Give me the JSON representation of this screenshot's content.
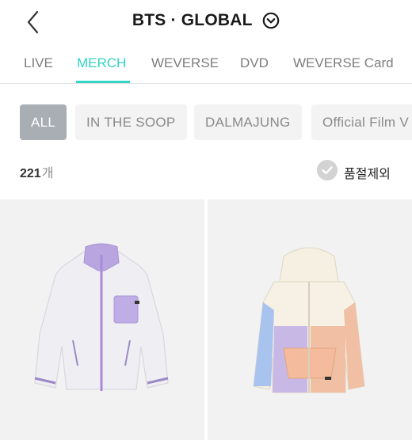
{
  "header": {
    "title": "BTS · GLOBAL",
    "back_icon": "chevron-left-icon",
    "title_icon": "chevron-down-circle-icon"
  },
  "tabs": [
    {
      "label": "LIVE",
      "active": false
    },
    {
      "label": "MERCH",
      "active": true
    },
    {
      "label": "WEVERSE",
      "active": false
    },
    {
      "label": "DVD",
      "active": false
    },
    {
      "label": "WEVERSE Card",
      "active": false
    }
  ],
  "chips": [
    {
      "label": "ALL",
      "active": true
    },
    {
      "label": "IN THE SOOP",
      "active": false
    },
    {
      "label": "DALMAJUNG",
      "active": false
    },
    {
      "label": "Official Film V",
      "active": false
    }
  ],
  "results": {
    "count": "221",
    "unit": "개",
    "exclude_soldout_label": "품절제외",
    "exclude_soldout_checked": false
  },
  "products": [
    {
      "image": "white-fleece-jacket-with-purple-zipper"
    },
    {
      "image": "colorblock-hooded-windbreaker"
    }
  ],
  "colors": {
    "accent": "#2fd6c2",
    "chip_active_bg": "#a9adb4",
    "chip_bg": "#f3f3f3",
    "card_bg": "#f2f2f2"
  }
}
